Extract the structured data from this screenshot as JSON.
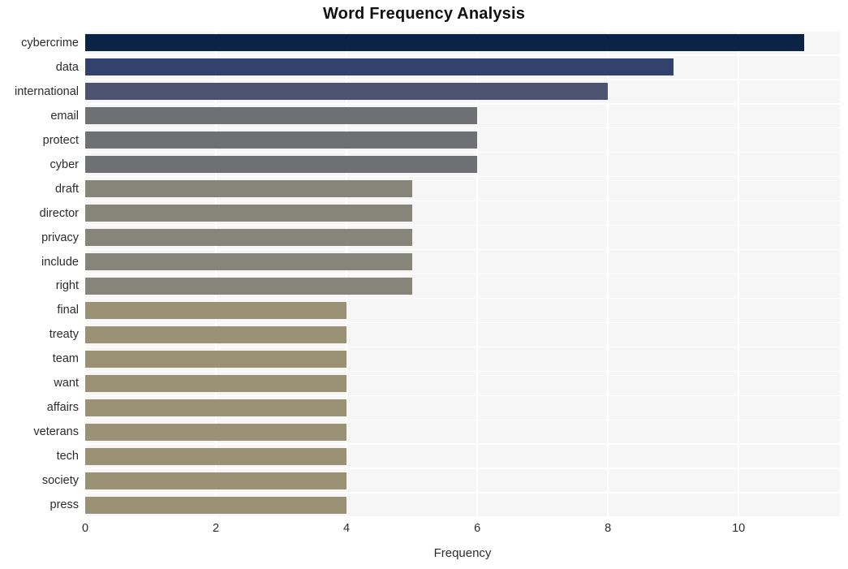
{
  "chart_data": {
    "type": "bar",
    "orientation": "horizontal",
    "title": "Word Frequency Analysis",
    "xlabel": "Frequency",
    "ylabel": "",
    "xlim": [
      0,
      11.55
    ],
    "xticks": [
      0,
      2,
      4,
      6,
      8,
      10
    ],
    "xtick_labels": [
      "0",
      "2",
      "4",
      "6",
      "8",
      "10"
    ],
    "grid": true,
    "legend": false,
    "categories": [
      "cybercrime",
      "data",
      "international",
      "email",
      "protect",
      "cyber",
      "draft",
      "director",
      "privacy",
      "include",
      "right",
      "final",
      "treaty",
      "team",
      "want",
      "affairs",
      "veterans",
      "tech",
      "society",
      "press"
    ],
    "values": [
      11,
      9,
      8,
      6,
      6,
      6,
      5,
      5,
      5,
      5,
      5,
      4,
      4,
      4,
      4,
      4,
      4,
      4,
      4,
      4
    ],
    "bar_colors": [
      "#0b2345",
      "#33426d",
      "#4c5370",
      "#6e7074",
      "#6e7074",
      "#6e7074",
      "#85857a",
      "#85857a",
      "#85857a",
      "#85857a",
      "#85857a",
      "#9b9275",
      "#9b9275",
      "#9b9275",
      "#9b9275",
      "#9b9275",
      "#9b9275",
      "#9b9275",
      "#9b9275",
      "#9b9275"
    ]
  },
  "style": {
    "plot_background": "#f6f6f7",
    "grid_color": "#ffffff",
    "figure_background": "#ffffff",
    "text_color": "#2b2b2b",
    "title_color": "#111111"
  }
}
